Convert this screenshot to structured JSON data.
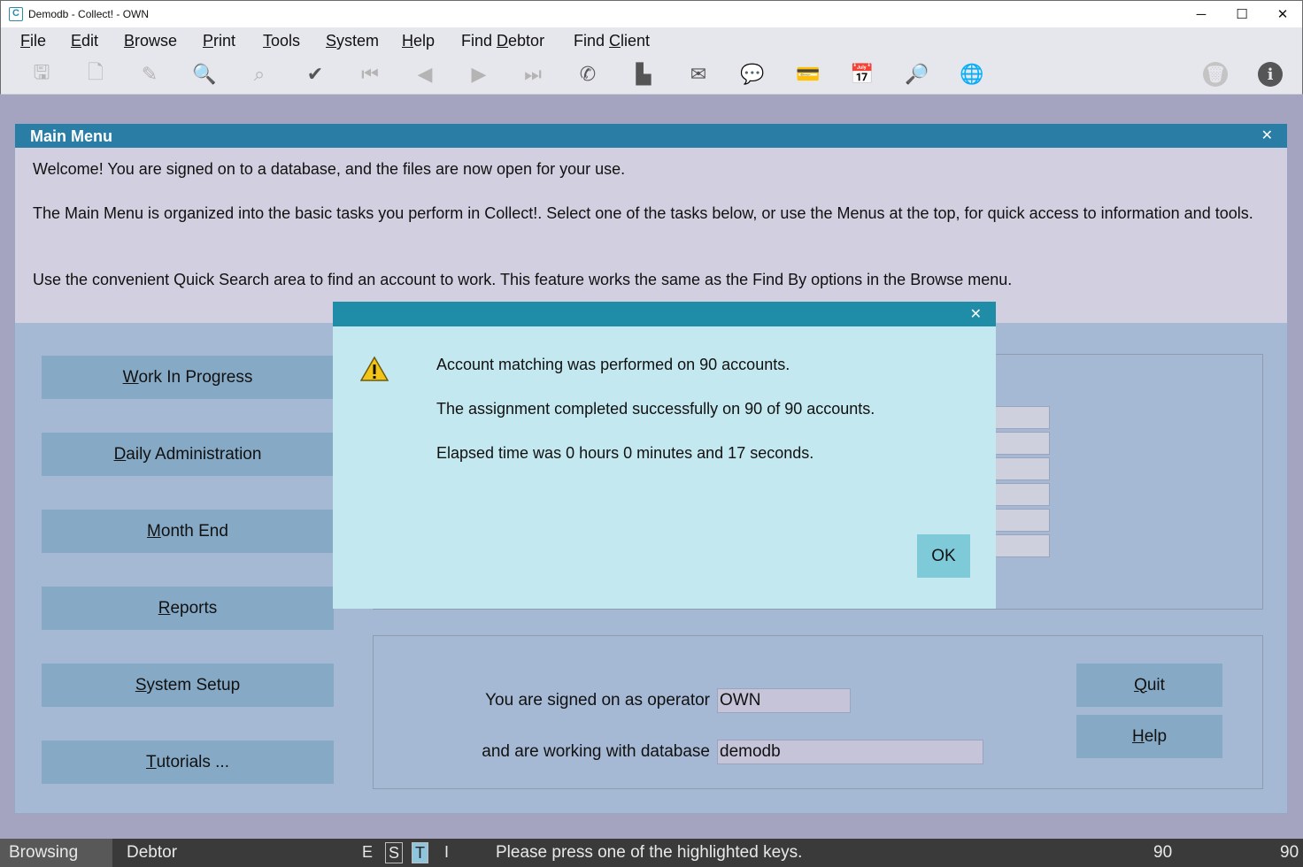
{
  "window": {
    "title": "Demodb - Collect! - OWN",
    "app_icon_letter": "C",
    "minimize_glyph": "─",
    "maximize_glyph": "☐",
    "close_glyph": "✕"
  },
  "menu": {
    "items": [
      {
        "label": "File",
        "mnemonic": "F",
        "rest": "ile"
      },
      {
        "label": "Edit",
        "mnemonic": "E",
        "rest": "dit"
      },
      {
        "label": "Browse",
        "mnemonic": "B",
        "rest": "rowse"
      },
      {
        "label": "Print",
        "mnemonic": "P",
        "rest": "rint"
      },
      {
        "label": "Tools",
        "mnemonic": "T",
        "rest": "ools"
      },
      {
        "label": "System",
        "mnemonic": "S",
        "rest": "ystem"
      },
      {
        "label": "Help",
        "mnemonic": "H",
        "rest": "elp"
      },
      {
        "label": "Find Debtor",
        "pre": "Find ",
        "mnemonic": "D",
        "rest": "ebtor"
      },
      {
        "label": "Find Client",
        "pre": "Find ",
        "mnemonic": "C",
        "rest": "lient"
      }
    ]
  },
  "toolbar": {
    "icons": [
      {
        "name": "save-icon",
        "glyph": "🖫",
        "enabled": false
      },
      {
        "name": "new-record-icon",
        "glyph": "🗋",
        "enabled": false
      },
      {
        "name": "edit-record-icon",
        "glyph": "✎",
        "enabled": false
      },
      {
        "name": "preview-icon",
        "glyph": "🔍",
        "enabled": false
      },
      {
        "name": "binoculars-icon",
        "glyph": "⌕",
        "enabled": false
      },
      {
        "name": "checkmark-icon",
        "glyph": "✔",
        "enabled": true
      },
      {
        "name": "first-record-icon",
        "glyph": "⏮",
        "enabled": false
      },
      {
        "name": "previous-record-icon",
        "glyph": "◀",
        "enabled": false
      },
      {
        "name": "next-record-icon",
        "glyph": "▶",
        "enabled": false
      },
      {
        "name": "last-record-icon",
        "glyph": "⏭",
        "enabled": false
      },
      {
        "name": "phone-icon",
        "glyph": "✆",
        "enabled": true
      },
      {
        "name": "print-icon",
        "glyph": "▙",
        "enabled": true
      },
      {
        "name": "email-icon",
        "glyph": "✉",
        "enabled": true
      },
      {
        "name": "chat-icon",
        "glyph": "💬",
        "enabled": true
      },
      {
        "name": "payment-icon",
        "glyph": "💳",
        "enabled": true
      },
      {
        "name": "calendar-add-icon",
        "glyph": "📅",
        "enabled": true
      },
      {
        "name": "search-icon",
        "glyph": "🔎",
        "enabled": true
      },
      {
        "name": "globe-icon",
        "glyph": "🌐",
        "enabled": true
      }
    ],
    "right_icons": [
      {
        "name": "delete-icon",
        "glyph": "🗑",
        "enabled": false
      },
      {
        "name": "info-icon",
        "glyph": "i",
        "enabled": true
      }
    ]
  },
  "main_menu": {
    "title": "Main Menu",
    "close_glyph": "✕",
    "intro": [
      "Welcome! You are signed on to a database, and the files are now open for your use.",
      "The Main Menu is organized into the basic tasks you perform in Collect!. Select one of the tasks below, or use the Menus at the top, for quick access to information and tools.",
      "Use the convenient Quick Search area to find an account to work. This feature works the same as the Find By options in the Browse menu."
    ],
    "buttons": [
      {
        "label": "Work In Progress",
        "mnemonic": "W",
        "rest": "ork In Progress"
      },
      {
        "label": "Daily Administration",
        "mnemonic": "D",
        "rest": "aily Administration"
      },
      {
        "label": "Month End",
        "mnemonic": "M",
        "rest": "onth End"
      },
      {
        "label": "Reports",
        "mnemonic": "R",
        "rest": "eports"
      },
      {
        "label": "System Setup",
        "mnemonic": "S",
        "rest": "ystem Setup"
      },
      {
        "label": "Tutorials ...",
        "mnemonic": "T",
        "rest": "utorials ..."
      }
    ],
    "signon": {
      "operator_label": "You are signed on as operator",
      "operator_value": "OWN",
      "database_label": "and are working with database",
      "database_value": "demodb"
    },
    "quit": {
      "label": "Quit",
      "mnemonic": "Q",
      "rest": "uit"
    },
    "help": {
      "label": "Help",
      "mnemonic": "H",
      "rest": "elp"
    }
  },
  "dialog": {
    "close_glyph": "✕",
    "icon": "warning-icon",
    "lines": [
      "Account matching was performed on 90 accounts.",
      "The assignment completed successfully on 90 of 90 accounts.",
      "Elapsed time was 0 hours 0 minutes and 17 seconds."
    ],
    "ok_label": "OK"
  },
  "statusbar": {
    "mode": "Browsing",
    "context": "Debtor",
    "keys": [
      "E",
      "S",
      "T",
      "I"
    ],
    "message": "Please press one of the highlighted keys.",
    "count_a": "90",
    "count_b": "90"
  },
  "colors": {
    "header_blue": "#2a7ea6",
    "dialog_header": "#1f8ca8",
    "dialog_bg": "#c4e8f0",
    "button_blue": "#86aac6"
  }
}
